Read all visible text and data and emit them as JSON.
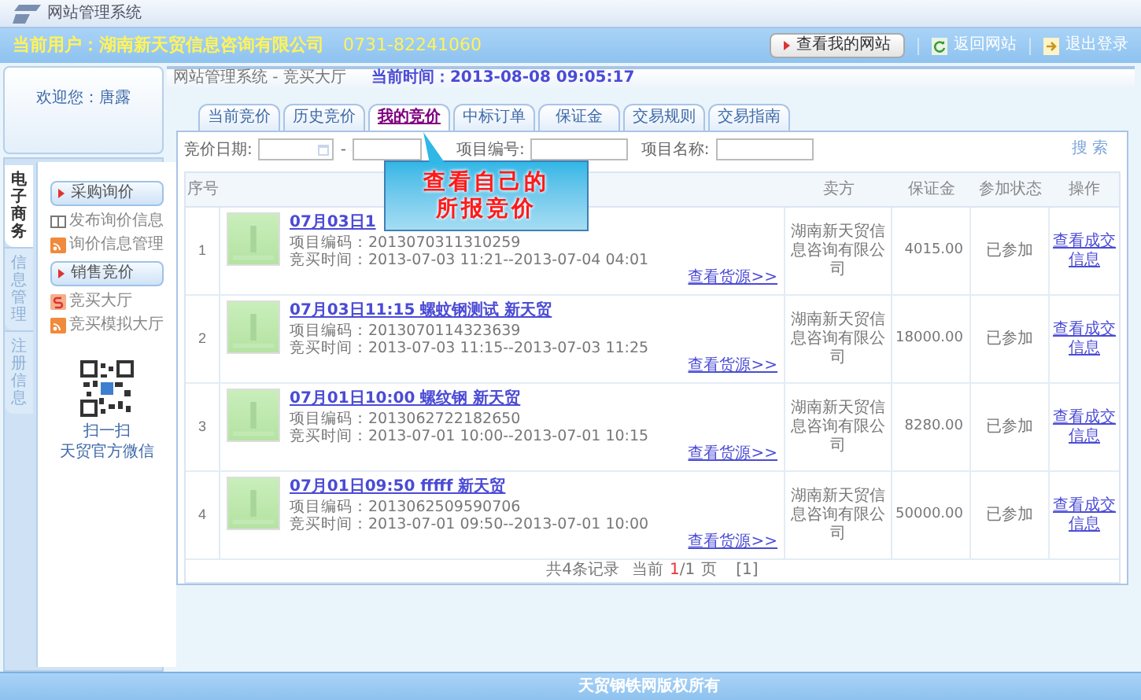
{
  "window": {
    "title": "网站管理系统"
  },
  "header": {
    "user_label": "当前用户：湖南新天贸信息咨询有限公司",
    "phone": "0731-82241060",
    "buttons": [
      {
        "kind": "primary",
        "label": "查看我的网站"
      },
      {
        "kind": "refresh",
        "label": "返回网站"
      },
      {
        "kind": "exit",
        "label": "退出登录"
      }
    ]
  },
  "welcome": "欢迎您：唐露",
  "side_tabs": [
    {
      "label": "电子商务",
      "selected": true
    },
    {
      "label": "信息管理",
      "selected": false
    },
    {
      "label": "注册信息",
      "selected": false
    }
  ],
  "menu": [
    {
      "kind": "group",
      "label": "采购询价"
    },
    {
      "kind": "book",
      "label": "发布询价信息"
    },
    {
      "kind": "rss",
      "label": "询价信息管理"
    },
    {
      "kind": "group",
      "label": "销售竞价"
    },
    {
      "kind": "swirl",
      "label": "竞买大厅"
    },
    {
      "kind": "rss",
      "label": "竞买模拟大厅"
    }
  ],
  "qr": {
    "line1": "扫一扫",
    "line2": "天贸官方微信"
  },
  "breadcrumb": "网站管理系统 - 竞买大厅",
  "current_time": "当前时间：2013-08-08 09:05:17",
  "tabs": [
    {
      "label": "当前竞价",
      "selected": false
    },
    {
      "label": "历史竞价",
      "selected": false
    },
    {
      "label": "我的竞价",
      "selected": true
    },
    {
      "label": "中标订单",
      "selected": false
    },
    {
      "label": "保证金",
      "selected": false
    },
    {
      "label": "交易规则",
      "selected": false
    },
    {
      "label": "交易指南",
      "selected": false
    }
  ],
  "filter": {
    "date_label": "竞价日期:",
    "dash": "-",
    "code_label": "项目编号:",
    "name_label": "项目名称:",
    "search": "搜 索"
  },
  "callout": {
    "lines": [
      "查看自己的",
      "所报竞价"
    ]
  },
  "table": {
    "columns": [
      "序号",
      "卖方",
      "保证金",
      "参加状态",
      "操作"
    ],
    "rows": [
      {
        "index": "1",
        "title": "07月03日1",
        "code": "项目编码：2013070311310259",
        "time": "竞买时间：2013-07-03 11:21--2013-07-04 04:01",
        "source": "查看货源>>",
        "seller": "湖南新天贸信息咨询有限公司",
        "deposit": "4015.00",
        "status": "已参加",
        "action": "查看成交信息"
      },
      {
        "index": "2",
        "title": "07月03日11:15 螺蚊钢测试 新天贸",
        "code": "项目编码：2013070114323639",
        "time": "竞买时间：2013-07-03 11:15--2013-07-03 11:25",
        "source": "查看货源>>",
        "seller": "湖南新天贸信息咨询有限公司",
        "deposit": "18000.00",
        "status": "已参加",
        "action": "查看成交信息"
      },
      {
        "index": "3",
        "title": "07月01日10:00 螺纹钢 新天贸",
        "code": "项目编码：2013062722182650",
        "time": "竞买时间：2013-07-01 10:00--2013-07-01 10:15",
        "source": "查看货源>>",
        "seller": "湖南新天贸信息咨询有限公司",
        "deposit": "8280.00",
        "status": "已参加",
        "action": "查看成交信息"
      },
      {
        "index": "4",
        "title": "07月01日09:50 fffff 新天贸",
        "code": "项目编码：2013062509590706",
        "time": "竞买时间：2013-07-01 09:50--2013-07-01 10:00",
        "source": "查看货源>>",
        "seller": "湖南新天贸信息咨询有限公司",
        "deposit": "50000.00",
        "status": "已参加",
        "action": "查看成交信息"
      }
    ]
  },
  "pagination": {
    "total": "共4条记录",
    "label": "当前",
    "current": "1",
    "of": "/1",
    "unit": "页",
    "pages": [
      "[1]"
    ]
  },
  "footer": "天贸钢铁网版权所有"
}
